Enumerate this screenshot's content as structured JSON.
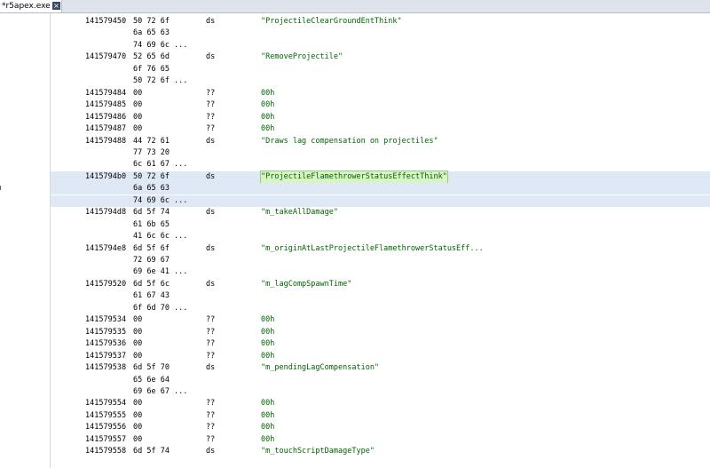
{
  "tab": {
    "title": "*r5apex.exe",
    "close_glyph": "×"
  },
  "listing": [
    {
      "addr": "141579450",
      "bytes": "50 72 6f",
      "mnem": "ds",
      "opnd": "\"ProjectileClearGroundEntThink\""
    },
    {
      "addr": "",
      "bytes": "6a 65 63",
      "mnem": "",
      "opnd": ""
    },
    {
      "addr": "",
      "bytes": "74 69 6c ...",
      "mnem": "",
      "opnd": ""
    },
    {
      "addr": "141579470",
      "bytes": "52 65 6d",
      "mnem": "ds",
      "opnd": "\"RemoveProjectile\""
    },
    {
      "addr": "",
      "bytes": "6f 76 65",
      "mnem": "",
      "opnd": ""
    },
    {
      "addr": "",
      "bytes": "50 72 6f ...",
      "mnem": "",
      "opnd": ""
    },
    {
      "addr": "141579484",
      "bytes": "00",
      "mnem": "??",
      "opnd": "00h"
    },
    {
      "addr": "141579485",
      "bytes": "00",
      "mnem": "??",
      "opnd": "00h"
    },
    {
      "addr": "141579486",
      "bytes": "00",
      "mnem": "??",
      "opnd": "00h"
    },
    {
      "addr": "141579487",
      "bytes": "00",
      "mnem": "??",
      "opnd": "00h"
    },
    {
      "addr": "141579488",
      "bytes": "44 72 61",
      "mnem": "ds",
      "opnd": "\"Draws lag compensation on projectiles\""
    },
    {
      "addr": "",
      "bytes": "77 73 20",
      "mnem": "",
      "opnd": ""
    },
    {
      "addr": "",
      "bytes": "6c 61 67 ...",
      "mnem": "",
      "opnd": ""
    },
    {
      "addr": "1415794b0",
      "bytes": "50 72 6f",
      "mnem": "ds",
      "opnd": "\"ProjectileFlamethrowerStatusEffectThink\"",
      "selected": true
    },
    {
      "addr": "",
      "bytes": "6a 65 63",
      "mnem": "",
      "opnd": "",
      "selected": true
    },
    {
      "addr": "",
      "bytes": "74 69 6c ...",
      "mnem": "",
      "opnd": "",
      "selected": true
    },
    {
      "addr": "1415794d8",
      "bytes": "6d 5f 74",
      "mnem": "ds",
      "opnd": "\"m_takeAllDamage\""
    },
    {
      "addr": "",
      "bytes": "61 6b 65",
      "mnem": "",
      "opnd": ""
    },
    {
      "addr": "",
      "bytes": "41 6c 6c ...",
      "mnem": "",
      "opnd": ""
    },
    {
      "addr": "1415794e8",
      "bytes": "6d 5f 6f",
      "mnem": "ds",
      "opnd": "\"m_originAtLastProjectileFlamethrowerStatusEff..."
    },
    {
      "addr": "",
      "bytes": "72 69 67",
      "mnem": "",
      "opnd": ""
    },
    {
      "addr": "",
      "bytes": "69 6e 41 ...",
      "mnem": "",
      "opnd": ""
    },
    {
      "addr": "141579520",
      "bytes": "6d 5f 6c",
      "mnem": "ds",
      "opnd": "\"m_lagCompSpawnTime\""
    },
    {
      "addr": "",
      "bytes": "61 67 43",
      "mnem": "",
      "opnd": ""
    },
    {
      "addr": "",
      "bytes": "6f 6d 70 ...",
      "mnem": "",
      "opnd": ""
    },
    {
      "addr": "141579534",
      "bytes": "00",
      "mnem": "??",
      "opnd": "00h"
    },
    {
      "addr": "141579535",
      "bytes": "00",
      "mnem": "??",
      "opnd": "00h"
    },
    {
      "addr": "141579536",
      "bytes": "00",
      "mnem": "??",
      "opnd": "00h"
    },
    {
      "addr": "141579537",
      "bytes": "00",
      "mnem": "??",
      "opnd": "00h"
    },
    {
      "addr": "141579538",
      "bytes": "6d 5f 70",
      "mnem": "ds",
      "opnd": "\"m_pendingLagCompensation\""
    },
    {
      "addr": "",
      "bytes": "65 6e 64",
      "mnem": "",
      "opnd": ""
    },
    {
      "addr": "",
      "bytes": "69 6e 67 ...",
      "mnem": "",
      "opnd": ""
    },
    {
      "addr": "141579554",
      "bytes": "00",
      "mnem": "??",
      "opnd": "00h"
    },
    {
      "addr": "141579555",
      "bytes": "00",
      "mnem": "??",
      "opnd": "00h"
    },
    {
      "addr": "141579556",
      "bytes": "00",
      "mnem": "??",
      "opnd": "00h"
    },
    {
      "addr": "141579557",
      "bytes": "00",
      "mnem": "??",
      "opnd": "00h"
    },
    {
      "addr": "141579558",
      "bytes": "6d 5f 74",
      "mnem": "ds",
      "opnd": "\"m_touchScriptDamageType\""
    }
  ]
}
